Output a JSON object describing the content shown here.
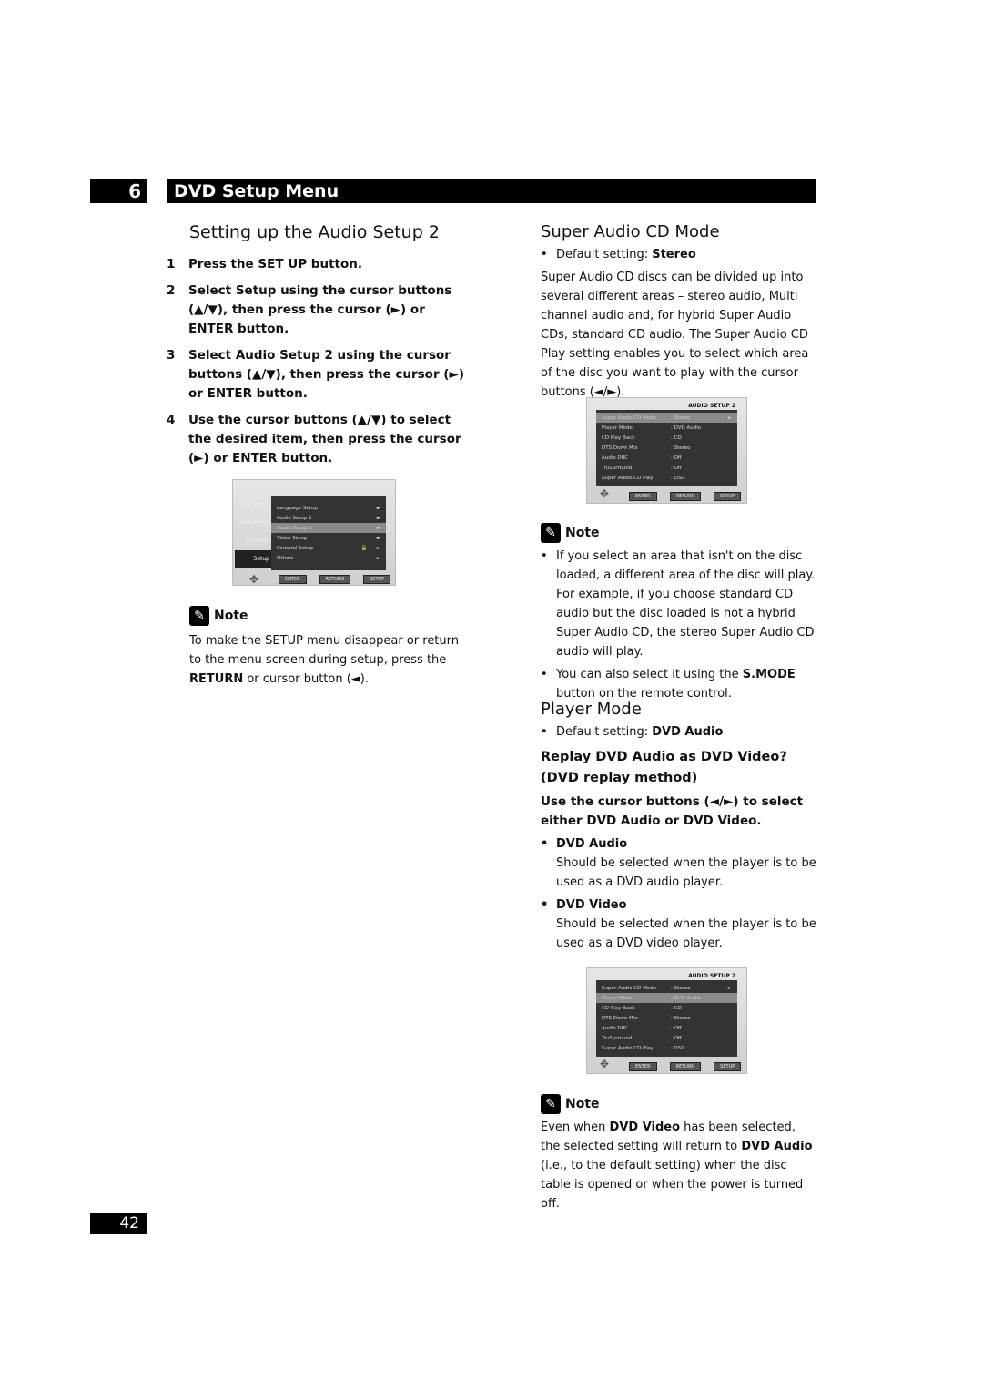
{
  "header": {
    "chapter": "6",
    "title": "DVD Setup Menu"
  },
  "left": {
    "title": "Setting up the Audio Setup 2",
    "steps": [
      {
        "n": "1",
        "text": "Press the SET UP button."
      },
      {
        "n": "2",
        "text": "Select Setup using the cursor buttons (▲/▼), then press the cursor (►) or ENTER button."
      },
      {
        "n": "3",
        "text": "Select Audio Setup 2 using the cursor buttons (▲/▼), then press the cursor (►) or ENTER button."
      },
      {
        "n": "4",
        "text": "Use the cursor buttons (▲/▼) to select the desired item, then press the cursor (►) or ENTER button."
      }
    ],
    "menu": {
      "side": [
        "Disc Menu",
        "Title Menu",
        "Function",
        "Setup"
      ],
      "items": [
        "Language Setup",
        "Audio Setup 1",
        "Audio Setup 2",
        "Video Setup",
        "Parental Setup",
        "Others"
      ],
      "buttons": [
        "ENTER",
        "RETURN",
        "SETUP"
      ]
    },
    "note_label": "Note",
    "note_a": "To make the SETUP menu disappear or return to the menu screen during setup, press the ",
    "note_b": "RETURN",
    "note_c": " or cursor button (◄)."
  },
  "audio_menu": {
    "title": "AUDIO SETUP 2",
    "rows": [
      [
        "Super Audio CD Mode",
        ": Stereo"
      ],
      [
        "Player Mode",
        ": DVD Audio"
      ],
      [
        "CD Play Back",
        ": CD"
      ],
      [
        "DTS Down Mix",
        ": Stereo"
      ],
      [
        "Audio DRC",
        ": Off"
      ],
      [
        "TruSurround",
        ": Off"
      ],
      [
        "Super Audio CD Play",
        ": DSD"
      ]
    ],
    "buttons": [
      "ENTER",
      "RETURN",
      "SETUP"
    ]
  },
  "right": {
    "sacd_title": "Super Audio CD Mode",
    "sacd_default_label": "Default setting: ",
    "sacd_default": "Stereo",
    "sacd_body": "Super Audio CD discs can be divided up into several different areas – stereo audio, Multi channel audio and, for hybrid Super Audio CDs, standard CD audio. The Super Audio CD Play setting enables you to select which area of the disc you want to play with the cursor buttons (◄/►).",
    "note_label": "Note",
    "note1": "If you select an area that isn't on the disc loaded, a different area of the disc will play. For example, if you choose standard CD audio but the disc loaded is not a hybrid Super Audio CD, the stereo Super Audio CD audio will play.",
    "note2a": "You can also select it using the ",
    "note2b": "S.MODE",
    "note2c": " button on the remote control.",
    "pm_title": "Player Mode",
    "pm_default_label": "Default setting: ",
    "pm_default": "DVD Audio",
    "pm_sub": "Replay DVD Audio as DVD Video? (DVD replay method)",
    "pm_instr": "Use the cursor buttons (◄/►) to select either DVD Audio or DVD Video.",
    "opt1": "DVD Audio",
    "opt1_desc": "Should be selected when the player is to be used as a DVD audio player.",
    "opt2": "DVD Video",
    "opt2_desc": "Should be selected when the player is to be used as a DVD video player.",
    "note3_label": "Note",
    "note3a": "Even when ",
    "note3b": "DVD Video",
    "note3c": " has been selected, the selected setting will return to ",
    "note3d": "DVD Audio",
    "note3e": " (i.e., to the default setting) when the disc table is opened or when the power is turned off."
  },
  "page_number": "42"
}
